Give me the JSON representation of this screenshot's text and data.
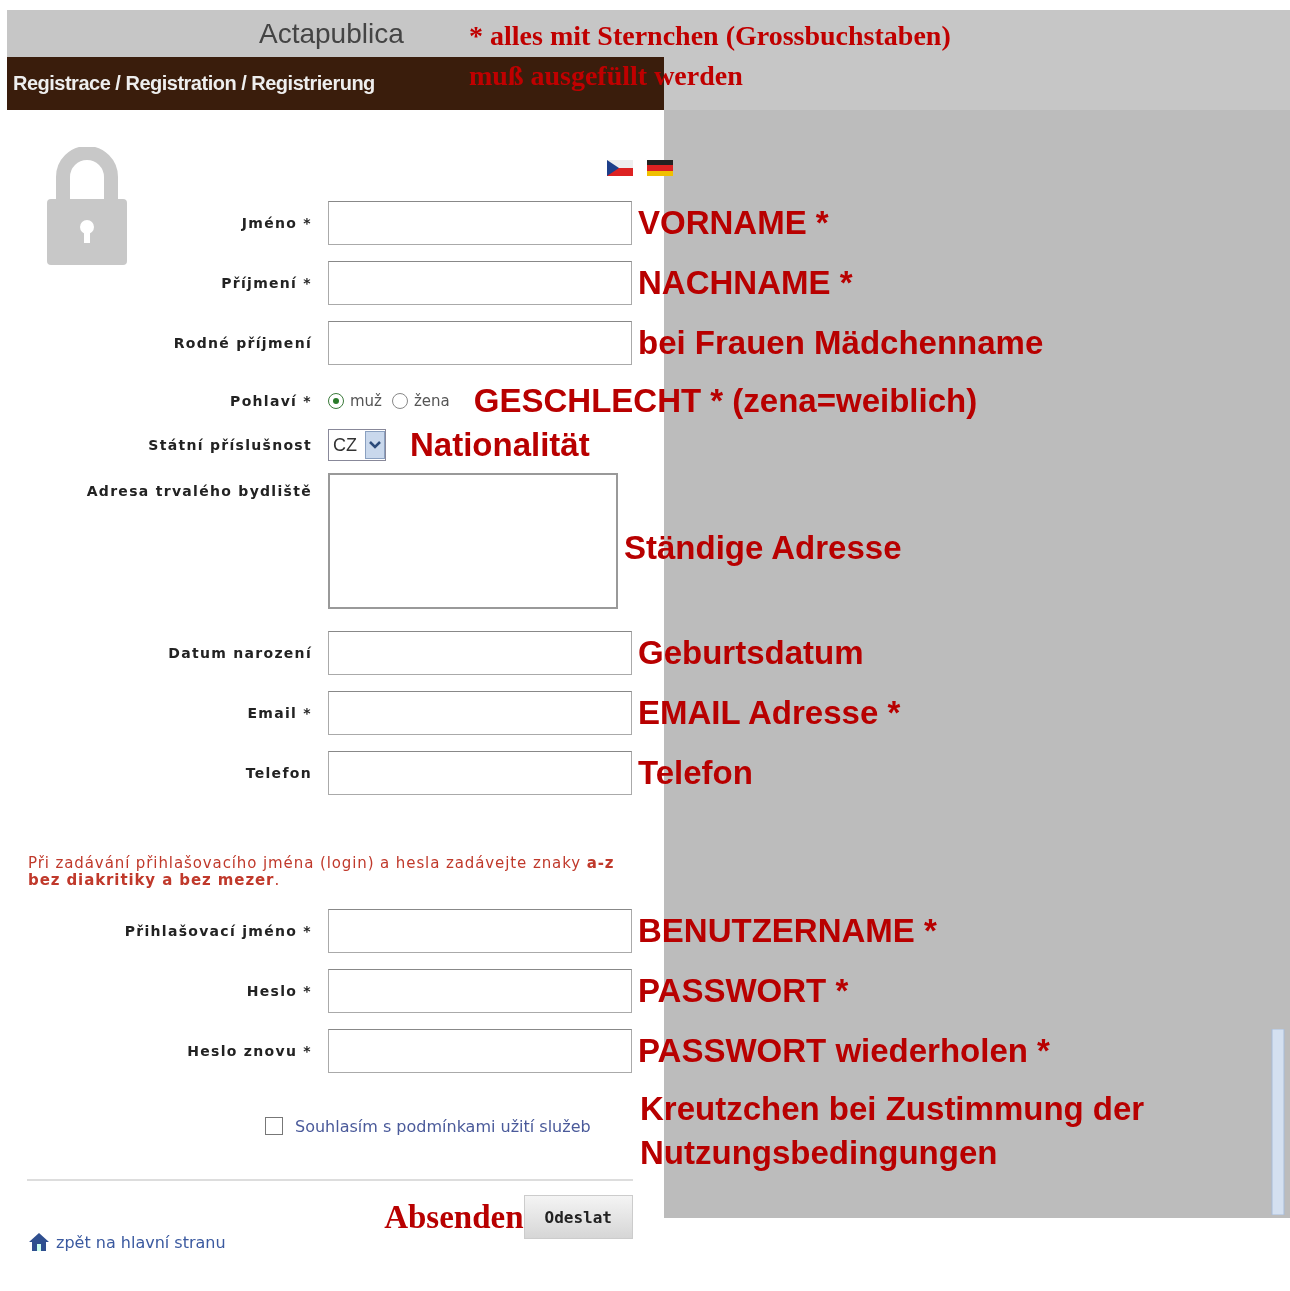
{
  "header": {
    "site_title": "Actapublica",
    "page_title": "Registrace / Registration / Registrierung"
  },
  "required_note": [
    "* alles mit Sternchen (Grossbuchstaben)",
    "muß ausgefüllt werden"
  ],
  "fields": [
    {
      "kind": "text",
      "label": "Jméno *",
      "annotation": "VORNAME *"
    },
    {
      "kind": "text",
      "label": "Příjmení *",
      "annotation": "NACHNAME *"
    },
    {
      "kind": "text",
      "label": "Rodné příjmení",
      "annotation": "bei Frauen Mädchenname"
    },
    {
      "kind": "radio",
      "label": "Pohlaví *",
      "options": [
        {
          "label": "muž",
          "selected": true
        },
        {
          "label": "žena",
          "selected": false
        }
      ],
      "annotation": "GESCHLECHT * (zena=weiblich)"
    },
    {
      "kind": "select",
      "label": "Státní příslušnost",
      "value": "CZ",
      "annotation": "Nationalität"
    },
    {
      "kind": "textarea",
      "label": "Adresa trvalého bydliště",
      "annotation": "Ständige Adresse"
    },
    {
      "kind": "text",
      "label": "Datum narození",
      "annotation": "Geburtsdatum"
    },
    {
      "kind": "text",
      "label": "Email *",
      "annotation": "EMAIL Adresse *"
    },
    {
      "kind": "text",
      "label": "Telefon",
      "annotation": "Telefon"
    }
  ],
  "login_note": "Při zadávání přihlašovacího jména (login) a hesla zadávejte znaky **a-z bez diakritiky a bez mezer**.",
  "login_fields": [
    {
      "kind": "text",
      "label": "Přihlašovací jméno *",
      "annotation": "BENUTZERNAME *"
    },
    {
      "kind": "text",
      "label": "Heslo *",
      "annotation": "PASSWORT *"
    },
    {
      "kind": "text",
      "label": "Heslo znovu *",
      "annotation": "PASSWORT wiederholen *"
    }
  ],
  "consent": {
    "label": "Souhlasím s podmínkami užití služeb",
    "checked": false,
    "annotation": "Kreutzchen bei Zustimmung der Nutzungsbedingungen"
  },
  "submit": {
    "label": "Odeslat",
    "annotation": "Absenden"
  },
  "back_link": "zpět na hlavní stranu"
}
